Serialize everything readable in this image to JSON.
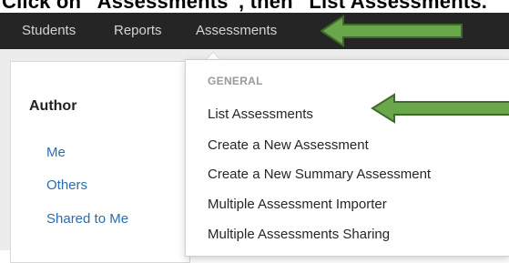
{
  "caption": {
    "text": "Click on “Assessments”, then “List Assessments.”"
  },
  "nav": {
    "items": [
      {
        "label": "Students"
      },
      {
        "label": "Reports"
      },
      {
        "label": "Assessments"
      }
    ]
  },
  "sidebar": {
    "heading": "Author",
    "links": [
      {
        "label": "Me"
      },
      {
        "label": "Others"
      },
      {
        "label": "Shared to Me"
      }
    ]
  },
  "dropdown": {
    "header": "GENERAL",
    "items": [
      {
        "label": "List Assessments"
      },
      {
        "label": "Create a New Assessment"
      },
      {
        "label": "Create a New Summary Assessment"
      },
      {
        "label": "Multiple Assessment Importer"
      },
      {
        "label": "Multiple Assessments Sharing"
      }
    ]
  },
  "colors": {
    "navbar": "#252525",
    "nav_text": "#d4d4d4",
    "link": "#2a6db0",
    "arrow_fill": "#6aa64a",
    "arrow_stroke": "#3f6b2a"
  },
  "icons": [
    "left-pointing-arrow-icon"
  ]
}
